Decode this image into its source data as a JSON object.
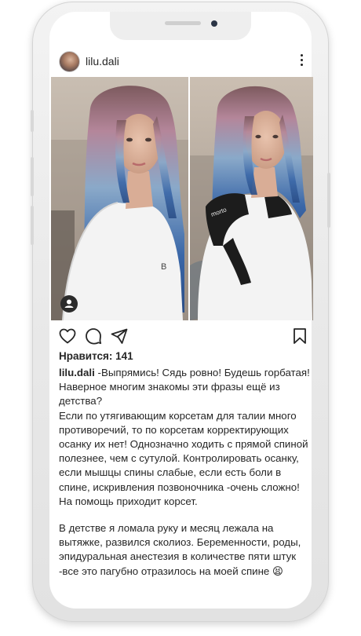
{
  "post": {
    "username": "lilu.dali",
    "likes_text": "Нравится: 141",
    "caption_username": "lilu.dali",
    "caption_paragraph_1": "-Выпрямись! Сядь ровно! Будешь горбатая! Наверное многим знакомы эти фразы ещё из детства?",
    "caption_paragraph_2": "Если по утягивающим корсетам для талии много противоречий, то по корсетам корректирующих осанку их нет! Однозначно ходить с прямой спиной полезнее, чем с сутулой. Контролировать осанку, если мышцы спины слабые, если есть боли в спине, искривления позвоночника -очень сложно! На помощь приходит корсет.",
    "caption_paragraph_3": "В детстве я ломала руку и месяц лежала на вытяжке, развился сколиоз. Беременности, роды, эпидуральная анестезия в количестве пяти штук -все это пагубно отразилось на моей спине 😫",
    "left_tshirt_letter": "B",
    "right_corset_brand": "morto"
  },
  "icons": {
    "more": "more-vertical-icon",
    "like": "heart-icon",
    "comment": "comment-icon",
    "share": "send-icon",
    "save": "bookmark-icon",
    "user_tag": "user-tag-icon"
  },
  "colors": {
    "text": "#262626",
    "hair_blue": "#3a67a8",
    "hair_pink": "#b77f9a",
    "tshirt": "#f3f3f3",
    "corset": "#1c1c1c"
  }
}
